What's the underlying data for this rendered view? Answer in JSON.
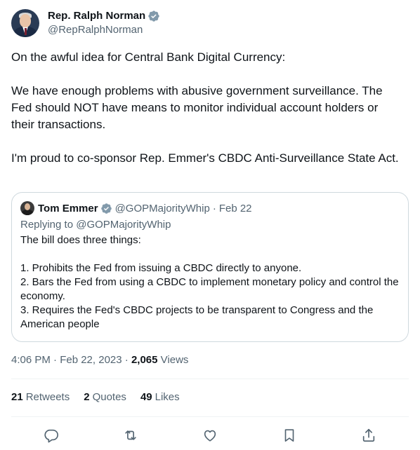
{
  "author": {
    "display_name": "Rep. Ralph Norman",
    "handle": "@RepRalphNorman",
    "verified_color": "#829aab"
  },
  "tweet": {
    "text": "On the awful idea for Central Bank Digital Currency:\n\nWe have enough problems with abusive government surveillance. The Fed should NOT have means to monitor individual account holders or their transactions.\n\nI'm proud to co-sponsor Rep. Emmer's CBDC Anti-Surveillance State Act."
  },
  "quote": {
    "display_name": "Tom Emmer",
    "handle": "@GOPMajorityWhip",
    "separator": "·",
    "date": "Feb 22",
    "replying_to": "Replying to @GOPMajorityWhip",
    "text": "The bill does three things:\n\n1. Prohibits the Fed from issuing a CBDC directly to anyone.\n2. Bars the Fed from using a CBDC to implement monetary policy and control the economy.\n3. Requires the Fed's CBDC projects to be transparent to Congress and the American people"
  },
  "meta": {
    "timestamp": "4:06 PM · Feb 22, 2023",
    "separator": "·",
    "views_count": "2,065",
    "views_label": "Views"
  },
  "stats": {
    "retweets_count": "21",
    "retweets_label": "Retweets",
    "quotes_count": "2",
    "quotes_label": "Quotes",
    "likes_count": "49",
    "likes_label": "Likes"
  },
  "actions": {
    "reply_icon": "reply-icon",
    "retweet_icon": "retweet-icon",
    "like_icon": "heart-icon",
    "bookmark_icon": "bookmark-icon",
    "share_icon": "share-icon"
  }
}
